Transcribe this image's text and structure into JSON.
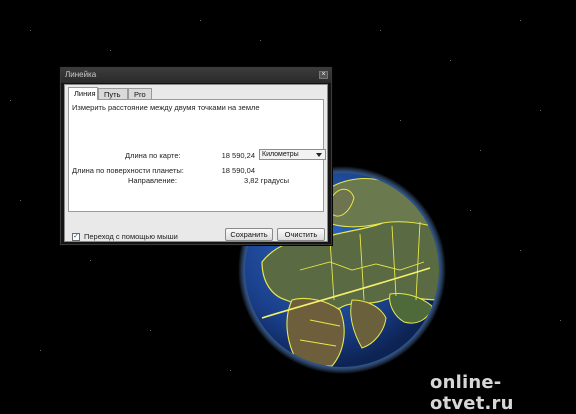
{
  "dialog": {
    "title": "Линейка",
    "close_glyph": "×",
    "tabs": [
      {
        "label": "Линия",
        "active": true
      },
      {
        "label": "Путь",
        "active": false
      },
      {
        "label": "Pro",
        "active": false
      }
    ],
    "description": "Измерить расстояние между двумя точками на земле",
    "map_length_label": "Длина по карте:",
    "map_length_value": "18 590,24",
    "units_selected": "Километры",
    "surface_length_label": "Длина по поверхности планеты:",
    "surface_length_value": "18 590,04",
    "direction_label": "Направление:",
    "direction_value": "3,82 градусы",
    "mouse_nav_label": "Переход с помощью мыши",
    "mouse_nav_checked": true,
    "check_glyph": "✓",
    "save_label": "Сохранить",
    "clear_label": "Очистить"
  },
  "watermark": "online-otvet.ru",
  "colors": {
    "background": "#000000",
    "measure_line": "#f4f06a",
    "borders": "#e8e84a",
    "ocean": "#1d4fa3",
    "land": "#4f5e3a"
  },
  "icons": {
    "close": "close-icon",
    "checkbox": "checkmark-icon",
    "dropdown": "chevron-down-icon"
  }
}
